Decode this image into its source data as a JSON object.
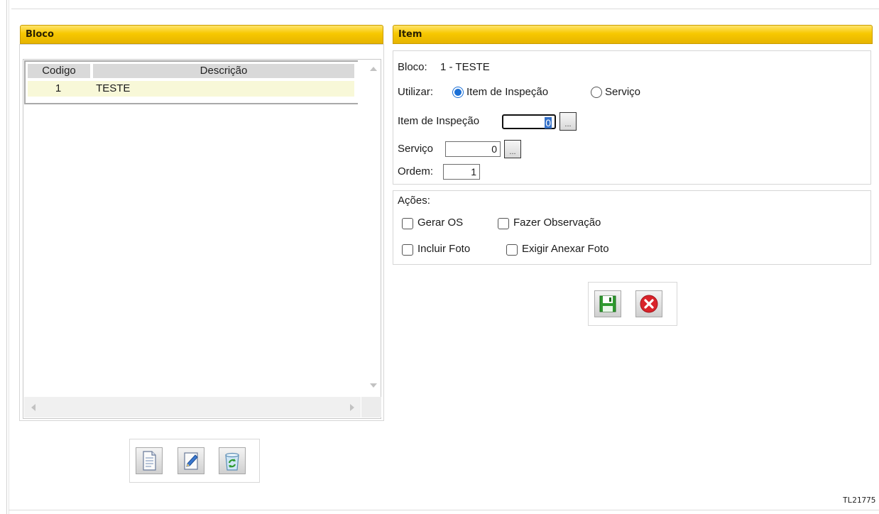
{
  "bloco_panel": {
    "title": "Bloco",
    "columns": [
      "Codigo",
      "Descrição"
    ],
    "rows": [
      {
        "codigo": "1",
        "descricao": "TESTE"
      }
    ],
    "toolbar": [
      "new-document-icon",
      "edit-icon",
      "recycle-bin-icon"
    ]
  },
  "item_panel": {
    "title": "Item",
    "bloco_label": "Bloco:",
    "bloco_value": "1 - TESTE",
    "utilizar_label": "Utilizar:",
    "option_item": "Item de Inspeção",
    "option_servico": "Serviço",
    "selected_option": "Item de Inspeção",
    "item_inspecao_label": "Item de Inspeção",
    "item_inspecao_value": "0",
    "servico_label": "Serviço",
    "servico_value": "0",
    "ordem_label": "Ordem:",
    "ordem_value": "1",
    "lookup_label": "...",
    "acoes_label": "Ações:",
    "actions": {
      "gerar_os": "Gerar OS",
      "fazer_observacao": "Fazer Observação",
      "incluir_foto": "Incluir Foto",
      "exigir_anexar_foto": "Exigir Anexar Foto"
    },
    "toolbar": [
      "save-icon",
      "cancel-icon"
    ]
  },
  "footer": {
    "screen_code": "TL21775"
  },
  "colors": {
    "header_yellow": "#f7c800",
    "row_highlight": "#f8f8d8",
    "radio_selected": "#1a6fd6",
    "cancel_red": "#d9232a",
    "save_green": "#2f9a2f"
  }
}
